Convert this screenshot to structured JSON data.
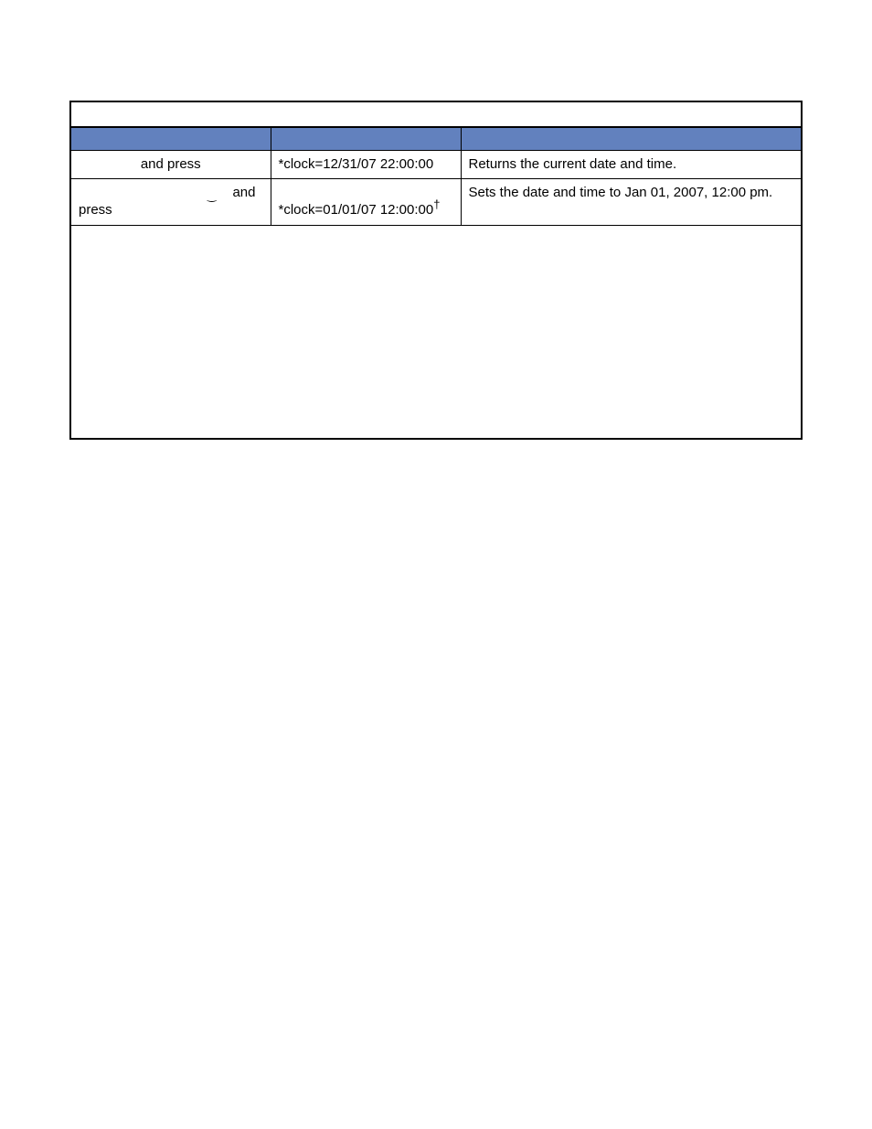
{
  "table": {
    "rows": [
      {
        "type_text": "and press",
        "display": "*clock=12/31/07 22:00:00",
        "description": "Returns the current date and time."
      },
      {
        "type_line1_and": "and",
        "type_line2": "press",
        "display_main": "*clock=01/01/07 12:00:00",
        "display_dagger": "†",
        "description": "Sets the date and time to Jan 01, 2007, 12:00 pm."
      }
    ]
  }
}
